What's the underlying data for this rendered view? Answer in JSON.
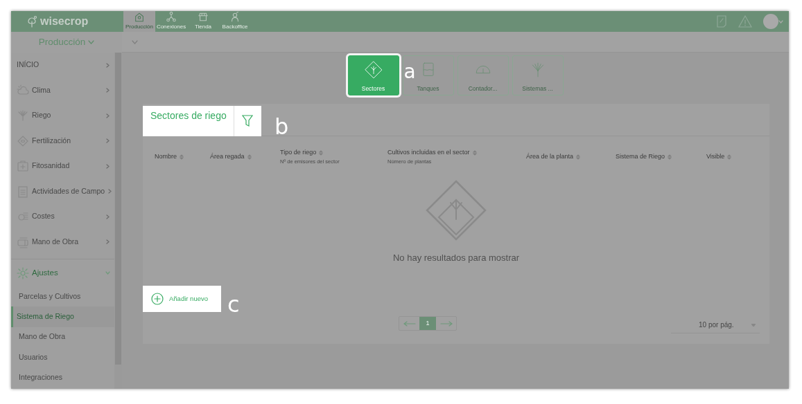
{
  "top_bar": {
    "logo": "wisecrop",
    "modules": [
      {
        "label": "Producción",
        "selected": true
      },
      {
        "label": "Conexiones",
        "selected": false
      },
      {
        "label": "Tienda",
        "selected": false
      },
      {
        "label": "Backoffice",
        "selected": false
      }
    ]
  },
  "sidebar": {
    "title": "Producción",
    "items": [
      {
        "label": "INÍCIO",
        "expanded": false
      },
      {
        "label": "Clima",
        "expanded": false
      },
      {
        "label": "Riego",
        "expanded": false
      },
      {
        "label": "Fertilización",
        "expanded": false
      },
      {
        "label": "Fitosanidad",
        "expanded": false
      },
      {
        "label": "Actividades de Campo",
        "expanded": false
      },
      {
        "label": "Costes",
        "expanded": false
      },
      {
        "label": "Mano de Obra",
        "expanded": false
      },
      {
        "label": "Ajustes",
        "expanded": true,
        "children": [
          {
            "label": "Parcelas y Cultivos",
            "selected": false
          },
          {
            "label": "Sistema de Riego",
            "selected": true
          },
          {
            "label": "Mano de Obra",
            "selected": false
          },
          {
            "label": "Usuarios",
            "selected": false
          },
          {
            "label": "Integraciones",
            "selected": false
          }
        ]
      }
    ]
  },
  "tiles": [
    {
      "label": "Sectores",
      "selected": true
    },
    {
      "label": "Tanques",
      "selected": false
    },
    {
      "label": "Contador...",
      "selected": false
    },
    {
      "label": "Sistemas ...",
      "selected": false
    }
  ],
  "card": {
    "title": "Sectores de riego",
    "columns": [
      {
        "label": "Nombre"
      },
      {
        "label": "Área regada"
      },
      {
        "label": "Tipo de riego",
        "sublabel": "Nº de emisores del sector"
      },
      {
        "label": "Cultivos incluidas en el sector",
        "sublabel": "Número de plantas"
      },
      {
        "label": "Área de la planta"
      },
      {
        "label": "Sistema de Riego"
      },
      {
        "label": "Visible"
      }
    ],
    "empty_message": "No hay resultados para mostrar",
    "add_button": "Añadir nuevo",
    "pagination": {
      "pages": [
        {
          "label": "1",
          "selected": true
        }
      ]
    },
    "page_size": "10 por pág."
  },
  "callouts": [
    "a",
    "b",
    "c"
  ]
}
